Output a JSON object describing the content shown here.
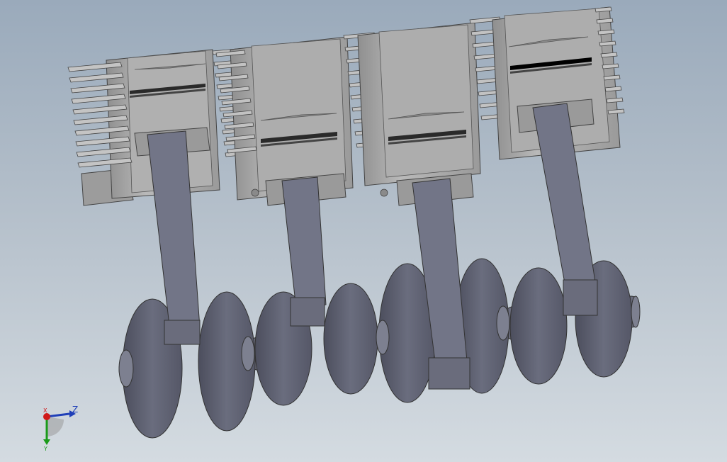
{
  "viewport": {
    "background_top": "#9aaabb",
    "background_bottom": "#d4dbe1",
    "model": {
      "cylinder_count": 4,
      "fin_color": "#b4b4b4",
      "cylinder_color": "#a9a9a9",
      "piston_color": "#a0a0a0",
      "rod_color": "#6f7283",
      "crank_color": "#5f6172",
      "ring_color": "#2a2a2a"
    }
  },
  "triad": {
    "x_label": "X",
    "y_label": "Y",
    "z_label": "Z",
    "x_color": "#d01818",
    "y_color": "#1a9b1a",
    "z_color": "#1f3fb8"
  }
}
